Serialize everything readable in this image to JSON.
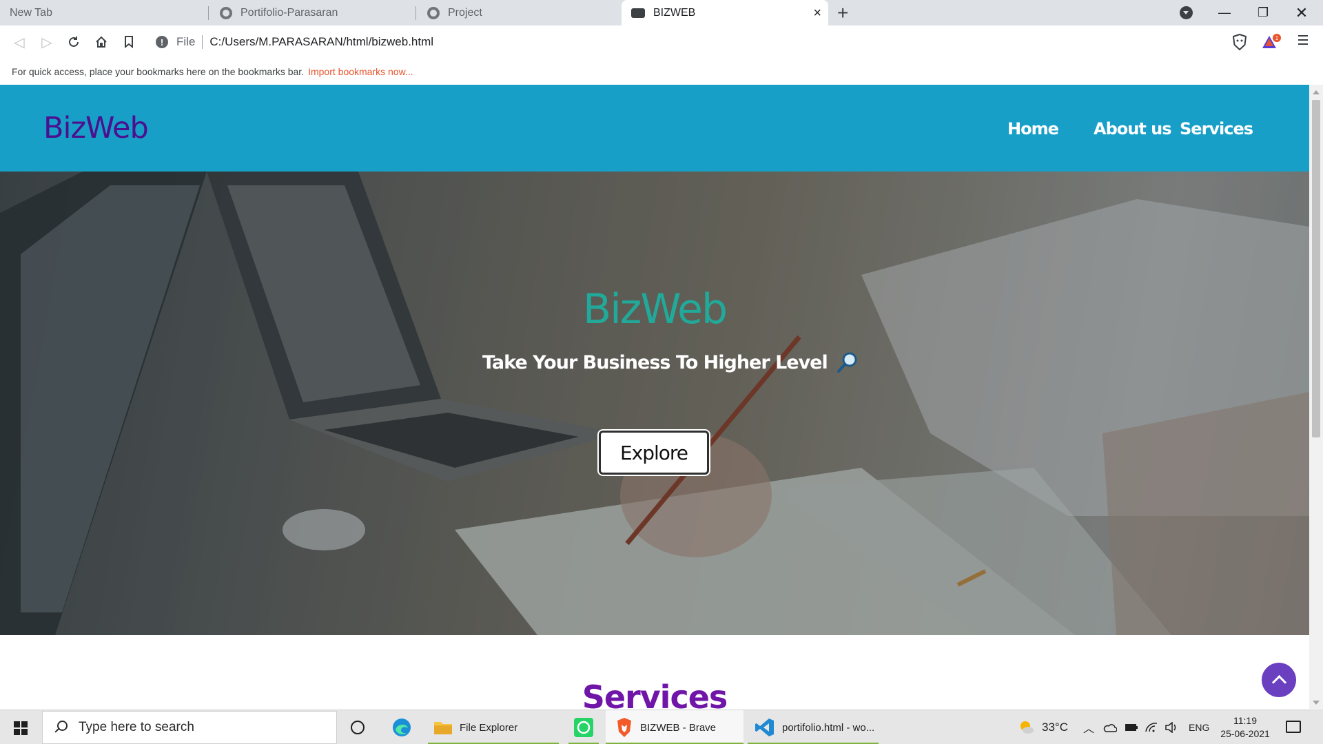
{
  "browser": {
    "tabs": [
      {
        "label": "New Tab"
      },
      {
        "label": "Portifolio-Parasaran"
      },
      {
        "label": "Project"
      },
      {
        "label": "BIZWEB"
      }
    ],
    "omnibox": {
      "scheme": "File",
      "url": "C:/Users/M.PARASARAN/html/bizweb.html"
    },
    "bookmarks_bar": {
      "hint": "For quick access, place your bookmarks here on the bookmarks bar.",
      "import_link": "Import bookmarks now..."
    },
    "rewards_badge": "1"
  },
  "site": {
    "logo": "BizWeb",
    "nav": [
      "Home",
      "About us",
      "Services"
    ],
    "hero": {
      "title": "BizWeb",
      "tagline": "Take Your Business To Higher Level",
      "button": "Explore"
    },
    "services_title": "Services",
    "colors": {
      "nav_bg": "#189fc7",
      "logo": "#4a108f",
      "hero_title": "#21a99a",
      "services_title": "#6f16a8",
      "to_top": "#6a3fc0"
    }
  },
  "taskbar": {
    "search_placeholder": "Type here to search",
    "apps": [
      {
        "label": "File Explorer",
        "icon": "folder-icon"
      },
      {
        "label": "BIZWEB - Brave",
        "icon": "brave-icon"
      },
      {
        "label": "portifolio.html - wo...",
        "icon": "vscode-icon"
      }
    ],
    "weather": "33°C",
    "language": "ENG",
    "time": "11:19",
    "date": "25-06-2021"
  }
}
